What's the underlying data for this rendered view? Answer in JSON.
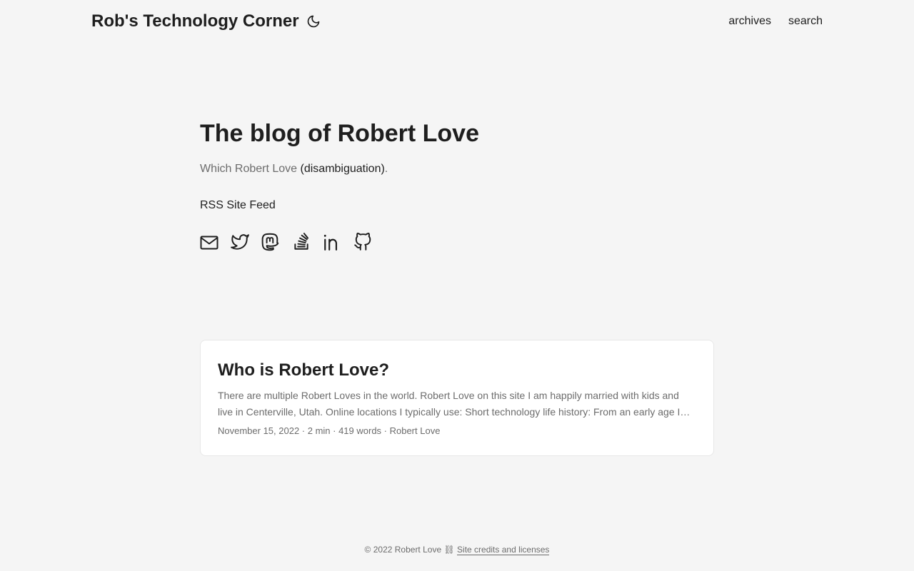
{
  "header": {
    "logo": "Rob's Technology Corner",
    "theme_toggle_icon": "moon-icon",
    "menu": [
      {
        "label": "archives"
      },
      {
        "label": "search"
      }
    ]
  },
  "home": {
    "title": "The blog of Robert Love",
    "subtitle_prefix": "Which Robert Love ",
    "subtitle_link": "(disambiguation)",
    "subtitle_suffix": ".",
    "rss_label": "RSS Site Feed",
    "social_icons": [
      "email-icon",
      "twitter-icon",
      "mastodon-icon",
      "stackoverflow-icon",
      "linkedin-icon",
      "github-icon"
    ]
  },
  "posts": [
    {
      "title": "Who is Robert Love?",
      "summary": "There are multiple Robert Loves in the world. Robert Love on this site I am happily married with kids and live in Centerville, Utah. Online locations I typically use: Short technology life history: From an early age I…",
      "meta": "November 15, 2022 · 2 min · 419 words · Robert Love"
    }
  ],
  "footer": {
    "copyright": "© 2022  Robert Love  ⛓ ",
    "credits_link": "Site credits and licenses"
  }
}
